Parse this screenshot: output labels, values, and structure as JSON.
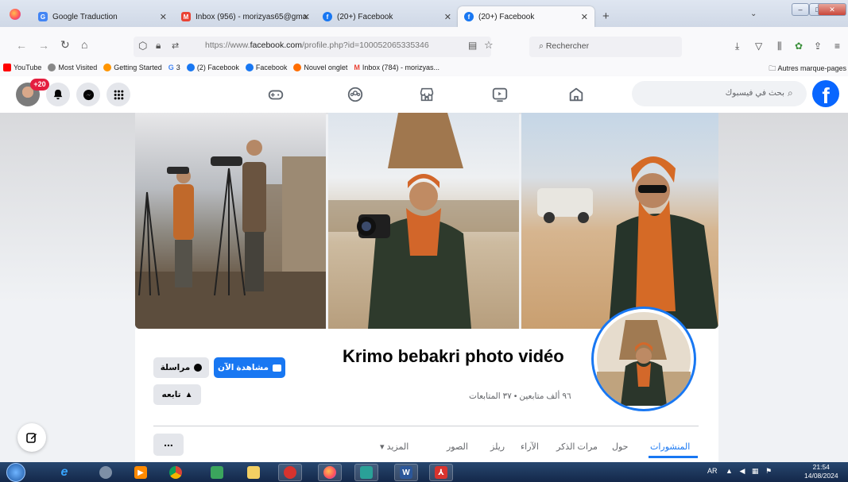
{
  "browser": {
    "tabs": [
      {
        "label": "Google Traduction",
        "icon": "google-translate-icon",
        "color": "#4285f4",
        "glyph": "G"
      },
      {
        "label": "Inbox (956) - morizyas65@gma",
        "icon": "gmail-icon",
        "color": "#ea4335",
        "glyph": "M"
      },
      {
        "label": "(20+) Facebook",
        "icon": "facebook-icon",
        "color": "#1877f2",
        "glyph": "f"
      },
      {
        "label": "(20+) Facebook",
        "icon": "facebook-icon",
        "color": "#1877f2",
        "glyph": "f"
      }
    ],
    "new_tab": "+",
    "url_prefix": "https://www.",
    "url_domain": "facebook.com",
    "url_path": "/profile.php?id=100052065335346",
    "search_placeholder": "Rechercher",
    "bookmarks": [
      {
        "label": "YouTube",
        "color": "#ff0000"
      },
      {
        "label": "Most Visited",
        "color": "#888888"
      },
      {
        "label": "Getting Started",
        "color": "#ff9500"
      },
      {
        "label": "3",
        "color": "#4285f4",
        "prefix": "G"
      },
      {
        "label": "(2) Facebook",
        "color": "#1877f2"
      },
      {
        "label": "Facebook",
        "color": "#1877f2"
      },
      {
        "label": "Nouvel onglet",
        "color": "#ff6d00"
      },
      {
        "label": "Inbox (784) - morizyas...",
        "color": "#ea4335"
      }
    ],
    "other_bookmarks": "Autres marque-pages"
  },
  "fb": {
    "notif_count": "+20",
    "search_placeholder": "بحث في فيسبوك",
    "logo": "f"
  },
  "profile": {
    "name": "Krimo bebakri photo vidéo",
    "followers": "٩٦ ألف متابعين • ٣٧ المتابعات",
    "watch_button": "مشاهدة الآن",
    "message_button": "مراسلة",
    "follow_button": "تابعه",
    "more_button": "...",
    "tabs": [
      {
        "label": "المنشورات",
        "active": true
      },
      {
        "label": "حول",
        "active": false
      },
      {
        "label": "مرات الذكر",
        "active": false
      },
      {
        "label": "الآراء",
        "active": false
      },
      {
        "label": "ريلز",
        "active": false
      },
      {
        "label": "الصور",
        "active": false
      },
      {
        "label": "المزيد ▾",
        "active": false
      }
    ]
  },
  "taskbar": {
    "language": "AR",
    "time": "21:54",
    "date": "14/08/2024"
  }
}
